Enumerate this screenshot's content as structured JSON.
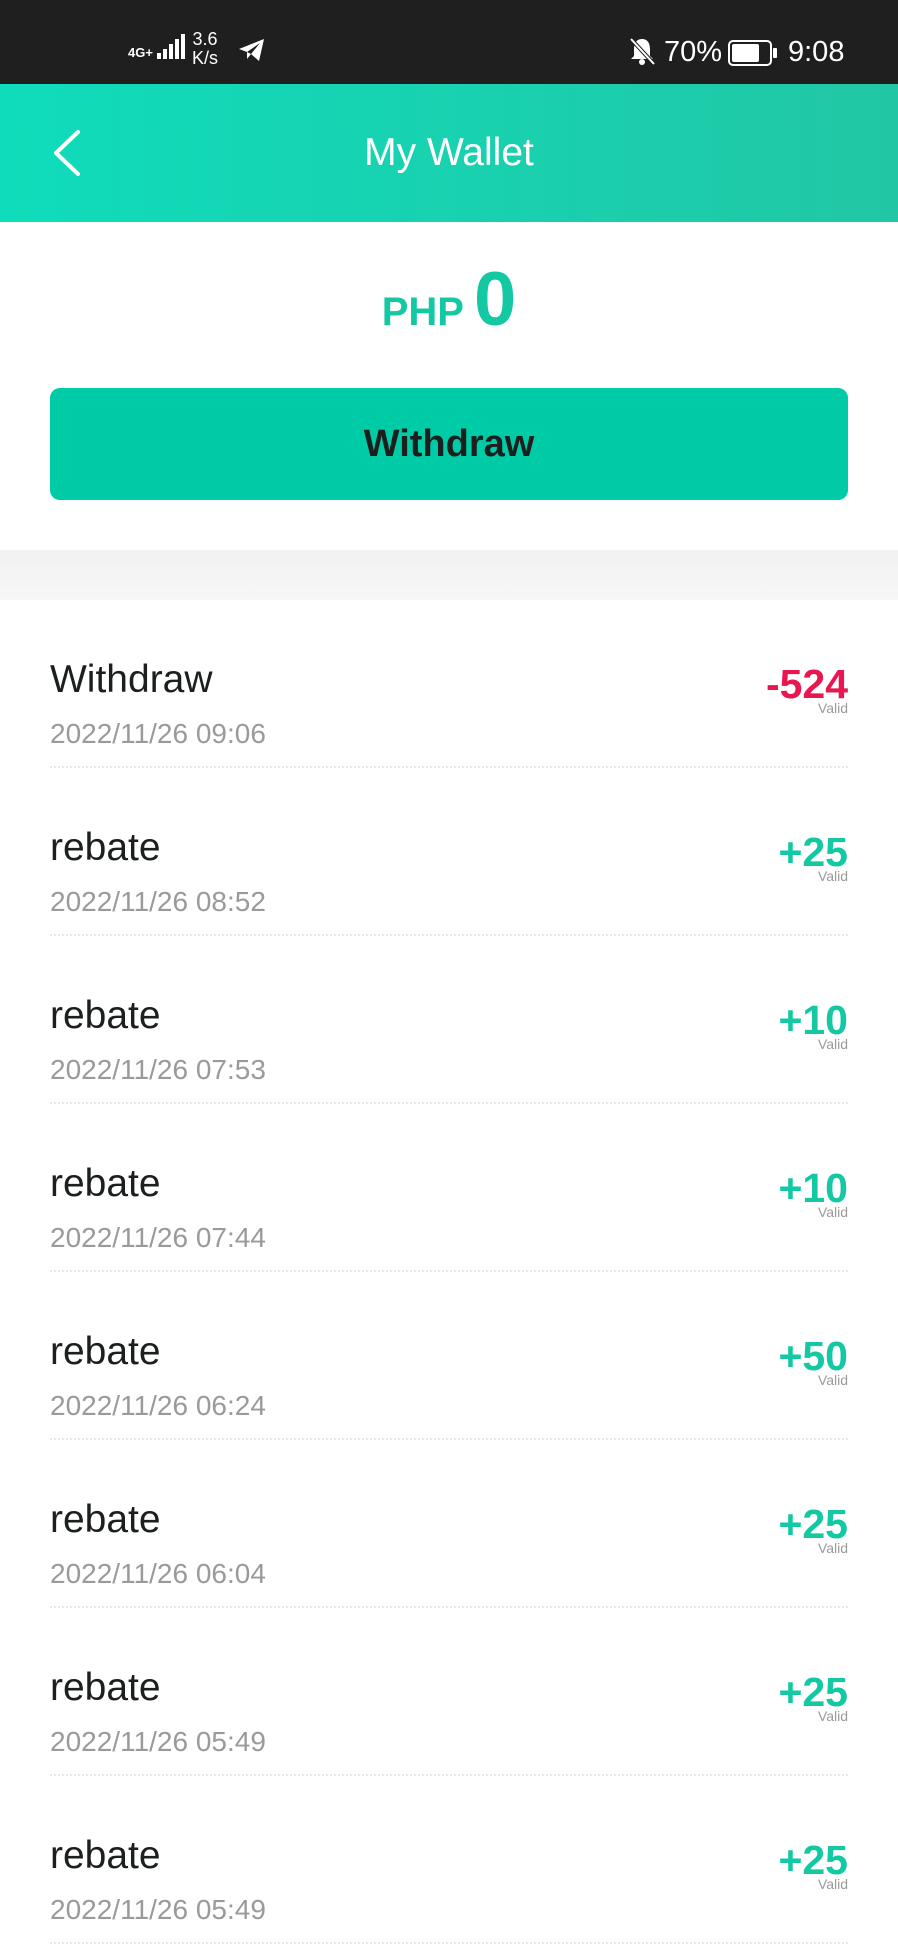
{
  "status_bar": {
    "network": "4G+",
    "speed_value": "3.6",
    "speed_unit": "K/s",
    "battery": "70%",
    "time": "9:08",
    "icons": [
      "signal-icon",
      "telegram-icon",
      "bell-off-icon",
      "battery-icon"
    ]
  },
  "header": {
    "title": "My Wallet",
    "back_icon": "chevron-left-icon"
  },
  "balance": {
    "currency": "PHP",
    "amount": "0"
  },
  "withdraw_button": {
    "label": "Withdraw"
  },
  "colors": {
    "accent": "#00cba7",
    "positive": "#14c8a4",
    "negative": "#e8174f"
  },
  "transactions": [
    {
      "title": "Withdraw",
      "time": "2022/11/26 09:06",
      "amount": "-524",
      "status": "Valid"
    },
    {
      "title": "rebate",
      "time": "2022/11/26 08:52",
      "amount": "+25",
      "status": "Valid"
    },
    {
      "title": "rebate",
      "time": "2022/11/26 07:53",
      "amount": "+10",
      "status": "Valid"
    },
    {
      "title": "rebate",
      "time": "2022/11/26 07:44",
      "amount": "+10",
      "status": "Valid"
    },
    {
      "title": "rebate",
      "time": "2022/11/26 06:24",
      "amount": "+50",
      "status": "Valid"
    },
    {
      "title": "rebate",
      "time": "2022/11/26 06:04",
      "amount": "+25",
      "status": "Valid"
    },
    {
      "title": "rebate",
      "time": "2022/11/26 05:49",
      "amount": "+25",
      "status": "Valid"
    },
    {
      "title": "rebate",
      "time": "2022/11/26 05:49",
      "amount": "+25",
      "status": "Valid"
    }
  ]
}
